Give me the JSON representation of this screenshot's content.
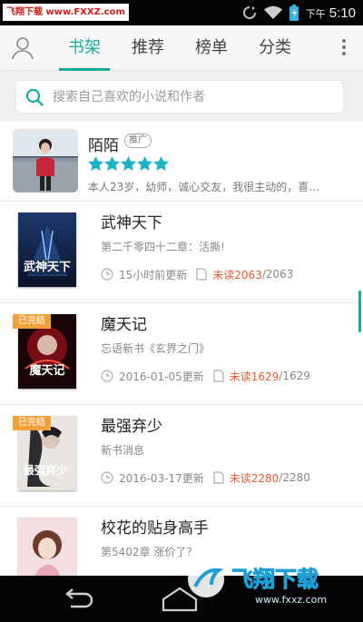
{
  "status_bar": {
    "watermark_text": "飞翔下载 www.FXXZ.com",
    "ampm": "下午",
    "time": "5:10",
    "icons": [
      "sync-icon",
      "wifi-icon",
      "battery-icon"
    ]
  },
  "tabs": {
    "items": [
      {
        "label": "书架",
        "active": true
      },
      {
        "label": "推荐",
        "active": false
      },
      {
        "label": "榜单",
        "active": false
      },
      {
        "label": "分类",
        "active": false
      }
    ]
  },
  "search": {
    "placeholder": "搜索自己喜欢的小说和作者"
  },
  "recommendation": {
    "name": "陌陌",
    "badge": "推广",
    "stars": 5,
    "description": "本人23岁，幼师，诚心交友，我很主动的，喜..."
  },
  "books": [
    {
      "title": "武神天下",
      "latest": "第二千零四十二章：活撕!",
      "updated": "15小时前更新",
      "unread_label": "未读2063",
      "total": "2063",
      "finished": false,
      "finished_label": "",
      "cover_text": "武神天下"
    },
    {
      "title": "魔天记",
      "latest": "忘语新书《玄界之门》",
      "updated": "2016-01-05更新",
      "unread_label": "未读1629",
      "total": "1629",
      "finished": true,
      "finished_label": "已完结",
      "cover_text": "魔天记"
    },
    {
      "title": "最强弃少",
      "latest": "新书消息",
      "updated": "2016-03-17更新",
      "unread_label": "未读2280",
      "total": "2280",
      "finished": true,
      "finished_label": "已完结",
      "cover_text": "最强弃少"
    },
    {
      "title": "校花的贴身高手",
      "latest": "第5402章 涨价了？",
      "updated": "",
      "unread_label": "",
      "total": "",
      "finished": false,
      "finished_label": "",
      "cover_text": ""
    }
  ],
  "watermark_bottom": {
    "brand": "飞翔下载",
    "url": "www.fxxz.com"
  },
  "colors": {
    "accent": "#17ad9b",
    "unread": "#e85b2a",
    "finished_tag": "#f0a13a",
    "star": "#19b3c5"
  }
}
